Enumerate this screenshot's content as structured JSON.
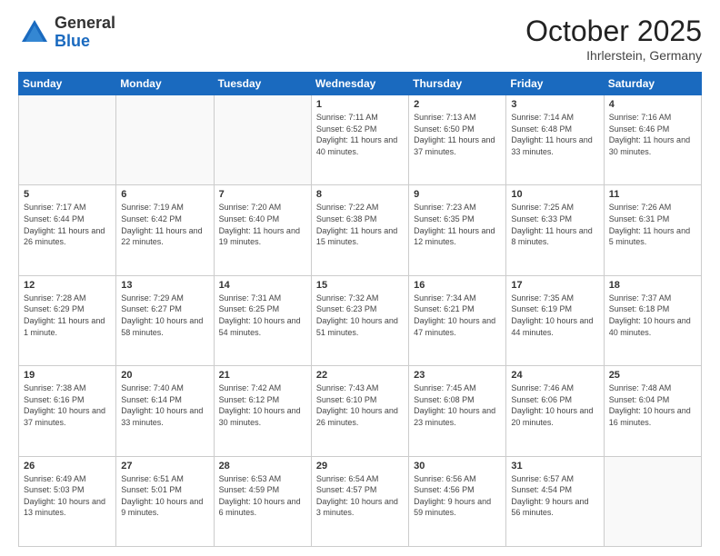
{
  "header": {
    "logo_general": "General",
    "logo_blue": "Blue",
    "title": "October 2025",
    "location": "Ihrlerstein, Germany"
  },
  "days_of_week": [
    "Sunday",
    "Monday",
    "Tuesday",
    "Wednesday",
    "Thursday",
    "Friday",
    "Saturday"
  ],
  "weeks": [
    [
      {
        "day": "",
        "info": ""
      },
      {
        "day": "",
        "info": ""
      },
      {
        "day": "",
        "info": ""
      },
      {
        "day": "1",
        "info": "Sunrise: 7:11 AM\nSunset: 6:52 PM\nDaylight: 11 hours and 40 minutes."
      },
      {
        "day": "2",
        "info": "Sunrise: 7:13 AM\nSunset: 6:50 PM\nDaylight: 11 hours and 37 minutes."
      },
      {
        "day": "3",
        "info": "Sunrise: 7:14 AM\nSunset: 6:48 PM\nDaylight: 11 hours and 33 minutes."
      },
      {
        "day": "4",
        "info": "Sunrise: 7:16 AM\nSunset: 6:46 PM\nDaylight: 11 hours and 30 minutes."
      }
    ],
    [
      {
        "day": "5",
        "info": "Sunrise: 7:17 AM\nSunset: 6:44 PM\nDaylight: 11 hours and 26 minutes."
      },
      {
        "day": "6",
        "info": "Sunrise: 7:19 AM\nSunset: 6:42 PM\nDaylight: 11 hours and 22 minutes."
      },
      {
        "day": "7",
        "info": "Sunrise: 7:20 AM\nSunset: 6:40 PM\nDaylight: 11 hours and 19 minutes."
      },
      {
        "day": "8",
        "info": "Sunrise: 7:22 AM\nSunset: 6:38 PM\nDaylight: 11 hours and 15 minutes."
      },
      {
        "day": "9",
        "info": "Sunrise: 7:23 AM\nSunset: 6:35 PM\nDaylight: 11 hours and 12 minutes."
      },
      {
        "day": "10",
        "info": "Sunrise: 7:25 AM\nSunset: 6:33 PM\nDaylight: 11 hours and 8 minutes."
      },
      {
        "day": "11",
        "info": "Sunrise: 7:26 AM\nSunset: 6:31 PM\nDaylight: 11 hours and 5 minutes."
      }
    ],
    [
      {
        "day": "12",
        "info": "Sunrise: 7:28 AM\nSunset: 6:29 PM\nDaylight: 11 hours and 1 minute."
      },
      {
        "day": "13",
        "info": "Sunrise: 7:29 AM\nSunset: 6:27 PM\nDaylight: 10 hours and 58 minutes."
      },
      {
        "day": "14",
        "info": "Sunrise: 7:31 AM\nSunset: 6:25 PM\nDaylight: 10 hours and 54 minutes."
      },
      {
        "day": "15",
        "info": "Sunrise: 7:32 AM\nSunset: 6:23 PM\nDaylight: 10 hours and 51 minutes."
      },
      {
        "day": "16",
        "info": "Sunrise: 7:34 AM\nSunset: 6:21 PM\nDaylight: 10 hours and 47 minutes."
      },
      {
        "day": "17",
        "info": "Sunrise: 7:35 AM\nSunset: 6:19 PM\nDaylight: 10 hours and 44 minutes."
      },
      {
        "day": "18",
        "info": "Sunrise: 7:37 AM\nSunset: 6:18 PM\nDaylight: 10 hours and 40 minutes."
      }
    ],
    [
      {
        "day": "19",
        "info": "Sunrise: 7:38 AM\nSunset: 6:16 PM\nDaylight: 10 hours and 37 minutes."
      },
      {
        "day": "20",
        "info": "Sunrise: 7:40 AM\nSunset: 6:14 PM\nDaylight: 10 hours and 33 minutes."
      },
      {
        "day": "21",
        "info": "Sunrise: 7:42 AM\nSunset: 6:12 PM\nDaylight: 10 hours and 30 minutes."
      },
      {
        "day": "22",
        "info": "Sunrise: 7:43 AM\nSunset: 6:10 PM\nDaylight: 10 hours and 26 minutes."
      },
      {
        "day": "23",
        "info": "Sunrise: 7:45 AM\nSunset: 6:08 PM\nDaylight: 10 hours and 23 minutes."
      },
      {
        "day": "24",
        "info": "Sunrise: 7:46 AM\nSunset: 6:06 PM\nDaylight: 10 hours and 20 minutes."
      },
      {
        "day": "25",
        "info": "Sunrise: 7:48 AM\nSunset: 6:04 PM\nDaylight: 10 hours and 16 minutes."
      }
    ],
    [
      {
        "day": "26",
        "info": "Sunrise: 6:49 AM\nSunset: 5:03 PM\nDaylight: 10 hours and 13 minutes."
      },
      {
        "day": "27",
        "info": "Sunrise: 6:51 AM\nSunset: 5:01 PM\nDaylight: 10 hours and 9 minutes."
      },
      {
        "day": "28",
        "info": "Sunrise: 6:53 AM\nSunset: 4:59 PM\nDaylight: 10 hours and 6 minutes."
      },
      {
        "day": "29",
        "info": "Sunrise: 6:54 AM\nSunset: 4:57 PM\nDaylight: 10 hours and 3 minutes."
      },
      {
        "day": "30",
        "info": "Sunrise: 6:56 AM\nSunset: 4:56 PM\nDaylight: 9 hours and 59 minutes."
      },
      {
        "day": "31",
        "info": "Sunrise: 6:57 AM\nSunset: 4:54 PM\nDaylight: 9 hours and 56 minutes."
      },
      {
        "day": "",
        "info": ""
      }
    ]
  ]
}
